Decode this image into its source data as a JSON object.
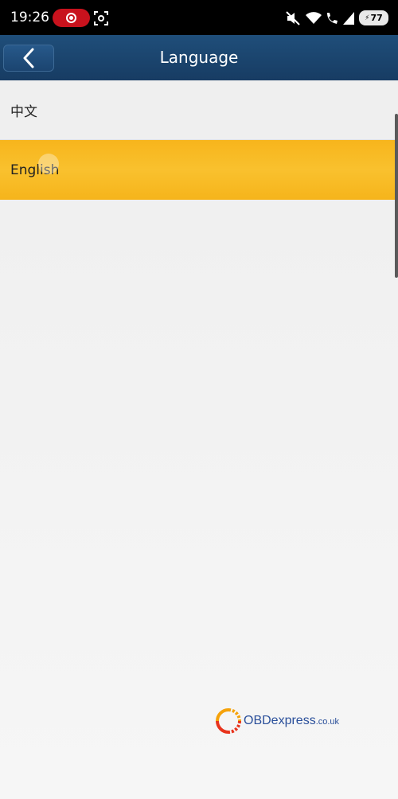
{
  "status_bar": {
    "time": "19:26",
    "battery_level": "77",
    "icons": [
      "record-icon",
      "screenshot-icon",
      "mute-icon",
      "wifi-icon",
      "volte-icon",
      "signal-icon",
      "battery-icon"
    ]
  },
  "header": {
    "title": "Language",
    "back_icon": "chevron-left-icon"
  },
  "languages": [
    {
      "label": "中文",
      "selected": false
    },
    {
      "label": "English",
      "selected": true
    }
  ],
  "watermark": {
    "brand": "OBDexpress",
    "domain": ".co.uk"
  },
  "colors": {
    "header_bg": "#1f4e7a",
    "selected_bg": "#f9c12e",
    "record_pill": "#c8121d"
  }
}
